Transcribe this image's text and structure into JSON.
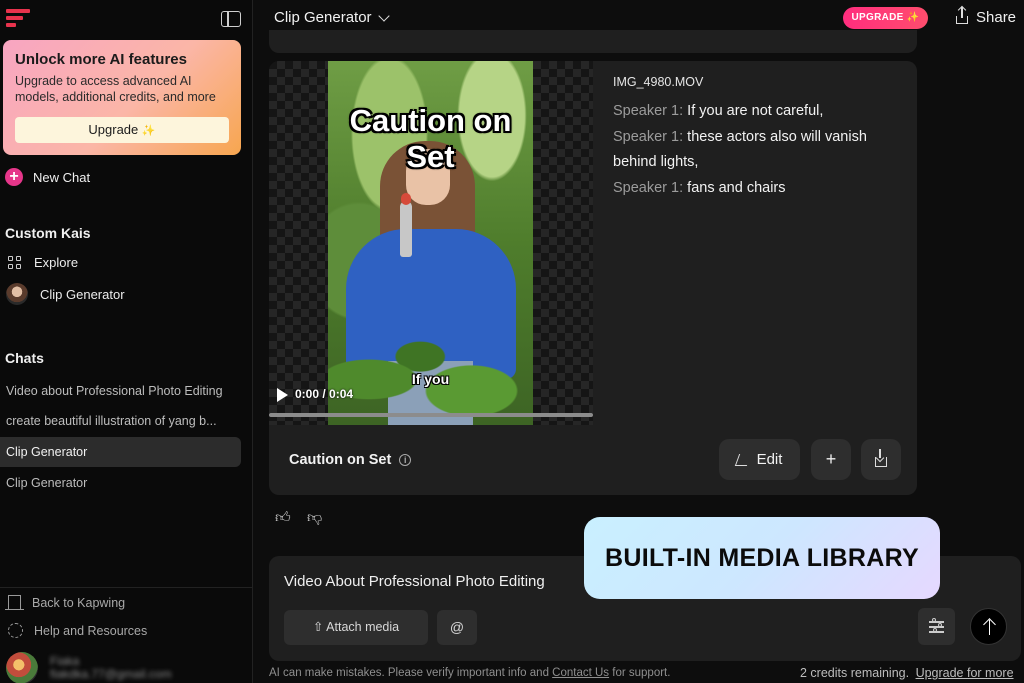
{
  "sidebar": {
    "promo": {
      "title": "Unlock more AI features",
      "text": "Upgrade to access advanced AI models, additional credits, and more",
      "button_label": "Upgrade",
      "button_icon": "sparkle-icon"
    },
    "new_chat_label": "New Chat",
    "custom_kais_heading": "Custom Kais",
    "custom_kais": [
      {
        "label": "Explore",
        "icon": "grid-icon"
      },
      {
        "label": "Clip Generator",
        "icon": "avatar"
      }
    ],
    "chats_heading": "Chats",
    "chats": [
      {
        "label": "Video about Professional Photo Editing",
        "active": false
      },
      {
        "label": "create beautiful illustration of yang b...",
        "active": false
      },
      {
        "label": "Clip Generator",
        "active": true
      },
      {
        "label": "Clip Generator",
        "active": false
      }
    ],
    "footer": {
      "back_label": "Back to Kapwing",
      "help_label": "Help and Resources",
      "user_name": "Fiaka",
      "user_email": "fiakdka.77@gmail.com"
    }
  },
  "header": {
    "title": "Clip Generator",
    "upgrade_label": "UPGRADE",
    "share_label": "Share"
  },
  "media_card": {
    "video": {
      "caption_title": "Caution on Set",
      "caption_sub": "If you",
      "time": "0:00 / 0:04",
      "progress": 0.0
    },
    "filename": "IMG_4980.MOV",
    "transcript": [
      {
        "speaker": "Speaker 1:",
        "text": "If you are not careful,"
      },
      {
        "speaker": "Speaker 1:",
        "text": "these actors also will vanish behind lights,"
      },
      {
        "speaker": "Speaker 1:",
        "text": "fans and chairs"
      }
    ],
    "title": "Caution on Set",
    "edit_label": "Edit"
  },
  "composer": {
    "text": "Video About Professional Photo Editing",
    "attach_label": "Attach media",
    "mention_label": "@"
  },
  "footer": {
    "disclaimer_pre": "AI can make mistakes. Please verify important info and",
    "contact_label": "Contact Us",
    "disclaimer_post": "for support.",
    "credits": "2 credits remaining.",
    "upgrade_more": "Upgrade for more"
  },
  "overlay_banner": "BUILT-IN MEDIA LIBRARY",
  "colors": {
    "accent": "#ff2d7e",
    "promo_gradient_start": "#f8a5c2",
    "promo_gradient_end": "#f7a64f"
  }
}
